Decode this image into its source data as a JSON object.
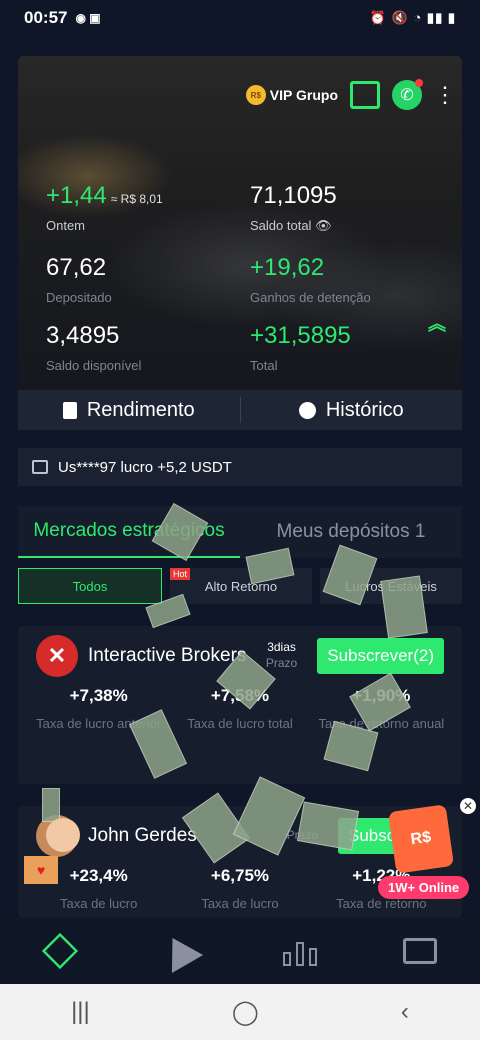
{
  "status_bar": {
    "time": "00:57",
    "right_icons": [
      "alarm-icon",
      "mute-icon",
      "wifi-icon",
      "signal-icon",
      "battery-icon"
    ]
  },
  "hero": {
    "vip_label": "VIP Grupo",
    "vip_coin": "R$",
    "yesterday_value": "+1,44",
    "yesterday_sub": "≈ R$ 8,01",
    "yesterday_label": "Ontem",
    "total_balance_value": "71,1095",
    "total_balance_label": "Saldo total",
    "deposited_value": "67,62",
    "deposited_label": "Depositado",
    "holding_gains_value": "+19,62",
    "holding_gains_label": "Ganhos de detenção",
    "available_value": "3,4895",
    "available_label": "Saldo disponível",
    "total_value": "+31,5895",
    "total_label": "Total"
  },
  "actions": {
    "rendimento": "Rendimento",
    "historico": "Histórico"
  },
  "notice": {
    "text": "Us****97 lucro +5,2 USDT"
  },
  "market_tabs": [
    "Mercados estratégicos",
    "Meus depósitos 1"
  ],
  "filters": [
    "Todos",
    "Alto Retorno",
    "Lucros Estáveis"
  ],
  "hot_badge": "Hot",
  "cards": [
    {
      "name": "Interactive Brokers",
      "term_value": "3dias",
      "term_label": "Prazo",
      "button": "Subscrever(2)",
      "stats": [
        {
          "value": "+7,38%",
          "label": "Taxa de lucro anterior"
        },
        {
          "value": "+7,58%",
          "label": "Taxa de lucro total"
        },
        {
          "value": "+1,90%",
          "label": "Taxa de retorno anual"
        }
      ]
    },
    {
      "name": "John Gerdes",
      "term_value": "",
      "term_label": "Prazo",
      "button": "Subscrever",
      "stats": [
        {
          "value": "+23,4%",
          "label": "Taxa de lucro"
        },
        {
          "value": "+6,75%",
          "label": "Taxa de lucro"
        },
        {
          "value": "+1,22%",
          "label": "Taxa de retorno"
        }
      ]
    }
  ],
  "promo": {
    "badge": "1W+ Online",
    "box_label": "R$"
  },
  "bottom_nav": [
    "cube-icon",
    "paper-plane-icon",
    "bar-chart-icon",
    "wallet-icon"
  ],
  "system_nav": {
    "recents": "|||",
    "home": "◯",
    "back": "‹"
  },
  "colors": {
    "accent": "#2ee86f",
    "background": "#0e1627",
    "card": "#161e2e",
    "logo_red": "#d52b2b"
  }
}
